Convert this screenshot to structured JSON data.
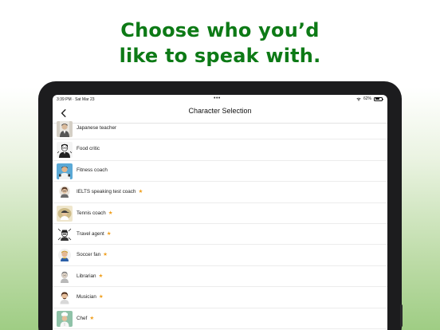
{
  "headline": {
    "line1": "Choose who you’d",
    "line2": "like to speak with."
  },
  "colors": {
    "headline": "#0d7a16",
    "star": "#f0a020",
    "background_bottom": "#9fcd84"
  },
  "status_bar": {
    "time_date": "3:39 PM · Sat Mar 23",
    "dots": "•••",
    "battery": "62%",
    "battery_level": 0.62
  },
  "nav": {
    "title": "Character Selection",
    "back_icon": "chevron-left-icon"
  },
  "characters": [
    {
      "name": "Japanese teacher",
      "star": "",
      "avatar": "japanese-teacher-avatar"
    },
    {
      "name": "Food critic",
      "star": "",
      "avatar": "food-critic-avatar"
    },
    {
      "name": "Fitness coach",
      "star": "",
      "avatar": "fitness-coach-avatar"
    },
    {
      "name": "IELTS speaking test coach",
      "star": "★",
      "avatar": "ielts-coach-avatar"
    },
    {
      "name": "Tennis coach",
      "star": "★",
      "avatar": "tennis-coach-avatar"
    },
    {
      "name": "Travel agent",
      "star": "★",
      "avatar": "travel-agent-avatar"
    },
    {
      "name": "Soccer fan",
      "star": "★",
      "avatar": "soccer-fan-avatar"
    },
    {
      "name": "Librarian",
      "star": "★",
      "avatar": "librarian-avatar"
    },
    {
      "name": "Musician",
      "star": "★",
      "avatar": "musician-avatar"
    },
    {
      "name": "Chef",
      "star": "★",
      "avatar": "chef-avatar"
    }
  ]
}
